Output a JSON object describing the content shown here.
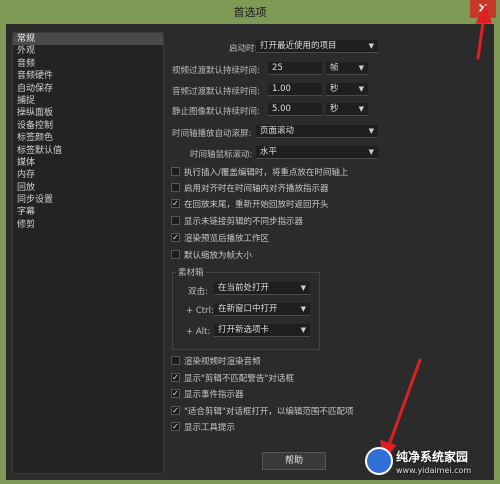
{
  "window": {
    "title": "首选项",
    "close_glyph": "×"
  },
  "sidebar": {
    "items": [
      {
        "label": "常规",
        "active": true
      },
      {
        "label": "外观"
      },
      {
        "label": "音频"
      },
      {
        "label": "音频硬件"
      },
      {
        "label": "自动保存"
      },
      {
        "label": "捕捉"
      },
      {
        "label": "操纵面板"
      },
      {
        "label": "设备控制"
      },
      {
        "label": "标签颜色"
      },
      {
        "label": "标签默认值"
      },
      {
        "label": "媒体"
      },
      {
        "label": "内存"
      },
      {
        "label": "回放"
      },
      {
        "label": "同步设置"
      },
      {
        "label": "字幕"
      },
      {
        "label": "修剪"
      }
    ]
  },
  "general": {
    "startup_label": "启动时:",
    "startup_value": "打开最近使用的项目",
    "video_trans_label": "视频过渡默认持续时间:",
    "video_trans_value": "25",
    "video_trans_unit": "帧",
    "audio_trans_label": "音频过渡默认持续时间:",
    "audio_trans_value": "1.00",
    "audio_trans_unit": "秒",
    "still_label": "静止图像默认持续时间:",
    "still_value": "5.00",
    "still_unit": "秒",
    "timeline_scroll_label": "时间轴播放自动滚屏:",
    "timeline_scroll_value": "页面滚动",
    "mouse_scroll_label": "时间轴鼠标滚动:",
    "mouse_scroll_value": "水平"
  },
  "checks_top": [
    {
      "label": "执行插入/覆盖编辑时，将重点放在时间轴上",
      "checked": false
    },
    {
      "label": "启用对齐时在时间轴内对齐播放指示器",
      "checked": false
    },
    {
      "label": "在回放末尾，重新开始回放时返回开头",
      "checked": true
    },
    {
      "label": "显示未链接剪辑的不同步指示器",
      "checked": false
    },
    {
      "label": "渲染预览后播放工作区",
      "checked": true
    },
    {
      "label": "默认缩放为帧大小",
      "checked": false
    }
  ],
  "bin": {
    "title": "素材箱",
    "double_label": "双击:",
    "double_value": "在当前处打开",
    "ctrl_label": "+ Ctrl:",
    "ctrl_value": "在新窗口中打开",
    "alt_label": "+ Alt:",
    "alt_value": "打开新选项卡"
  },
  "checks_bottom": [
    {
      "label": "渲染视频时渲染音频",
      "checked": false
    },
    {
      "label": "显示\"剪辑不匹配警告\"对话框",
      "checked": true
    },
    {
      "label": "显示事件指示器",
      "checked": true
    },
    {
      "label": "\"适合剪辑\"对话框打开，以编辑范围不匹配项",
      "checked": true
    },
    {
      "label": "显示工具提示",
      "checked": true
    }
  ],
  "help_button": "帮助",
  "watermark": {
    "title": "纯净系统家园",
    "url": "www.yidaimei.com"
  },
  "colors": {
    "arrow": "#e02020",
    "accent": "#c7392b"
  }
}
